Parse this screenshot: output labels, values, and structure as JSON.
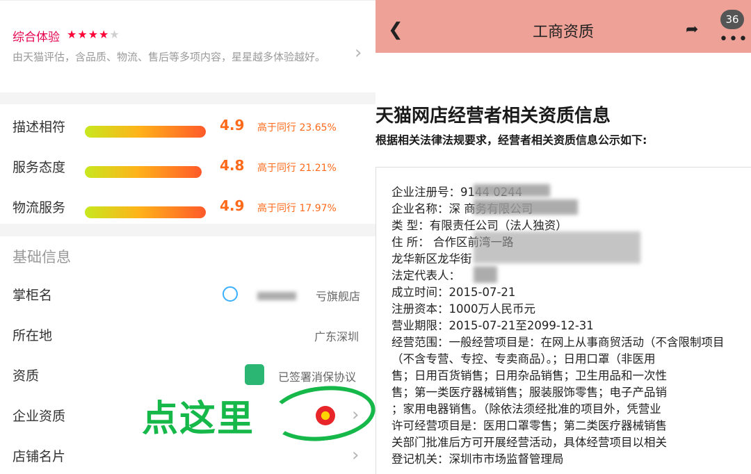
{
  "left": {
    "experience": {
      "title": "综合体验",
      "stars_filled": "★★★★",
      "stars_empty": "★",
      "description": "由天猫评估，含品质、物流、售后等多项内容，星星越多体验越好。"
    },
    "ratings": [
      {
        "label": "描述相符",
        "score": "4.9",
        "compare": "高于同行 23.65%"
      },
      {
        "label": "服务态度",
        "score": "4.8",
        "compare": "高于同行 21.21%"
      },
      {
        "label": "物流服务",
        "score": "4.9",
        "compare": "高于同行 17.97%"
      }
    ],
    "basic_info": {
      "heading": "基础信息",
      "rows": [
        {
          "label": "掌柜名",
          "value": "亏旗舰店"
        },
        {
          "label": "所在地",
          "value": "广东深圳"
        },
        {
          "label": "资质",
          "value": "已签署消保协议"
        },
        {
          "label": "企业资质",
          "value": ""
        },
        {
          "label": "店铺名片",
          "value": ""
        }
      ]
    },
    "annotation": "点这里"
  },
  "right": {
    "nav": {
      "title": "工商资质",
      "badge": "36"
    },
    "doc_title": "天猫网店经营者相关资质信息",
    "doc_subtitle": "根据相关法律法规要求，经营者相关资质信息公示如下:",
    "lines": [
      "企业注册号：9144          0244",
      "企业名称：深              商务有限公司",
      "类    型：有限责任公司（法人独资）",
      "住    所：                        合作区前湾一路",
      "                                  龙华新区龙华街",
      "法定代表人：",
      "成立时间：2015-07-21",
      "注册资本：1000万人民币元",
      "营业期限：2015-07-21至2099-12-31",
      "经营范围：一般经营项目是：在网上从事商贸活动（不含限制项目",
      "          （不含专营、专控、专卖商品）。；日用口罩（非医用",
      "          售；日用百货销售；日用杂品销售；卫生用品和一次性",
      "          售；第一类医疗器械销售；服装服饰零售；电子产品销",
      "          ；家用电器销售。（除依法须经批准的项目外，凭营业",
      "          许可经营项目是：医用口罩零售；第二类医疗器械销售",
      "          关部门批准后方可开展经营活动，具体经营项目以相关",
      "登记机关：深圳市市场监督管理局"
    ]
  },
  "colors": {
    "accent_red": "#e5004f",
    "rating_orange": "#ff6a1a",
    "annotation_green": "#16b84a",
    "nav_bg": "#eea196"
  }
}
